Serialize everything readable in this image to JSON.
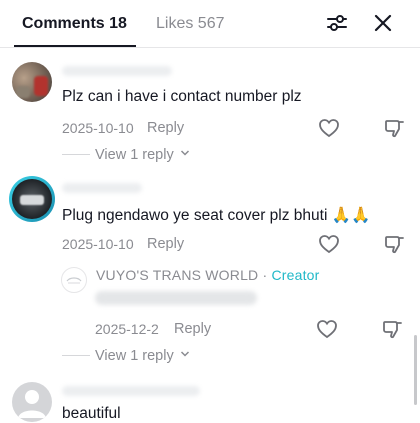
{
  "header": {
    "comments_tab": "Comments 18",
    "likes_tab": "Likes 567",
    "filter_icon": "sliders-icon",
    "close_icon": "close-icon"
  },
  "comments": [
    {
      "text": "Plz can i have i contact number plz",
      "date": "2025-10-10",
      "reply_label": "Reply",
      "view_replies": "View 1 reply"
    },
    {
      "text": "Plug ngendawo ye seat cover plz bhuti 🙏🙏",
      "date": "2025-10-10",
      "reply_label": "Reply",
      "reply": {
        "author": "VUYO'S TRANS WORLD",
        "separator": "·",
        "badge": "Creator",
        "date": "2025-12-2",
        "reply_label": "Reply"
      },
      "view_replies": "View 1 reply"
    },
    {
      "text": "beautiful"
    }
  ],
  "colors": {
    "text": "#161823",
    "muted": "#8a8b91",
    "creator_badge": "#20b8c8",
    "divider": "#e6e6e8"
  }
}
